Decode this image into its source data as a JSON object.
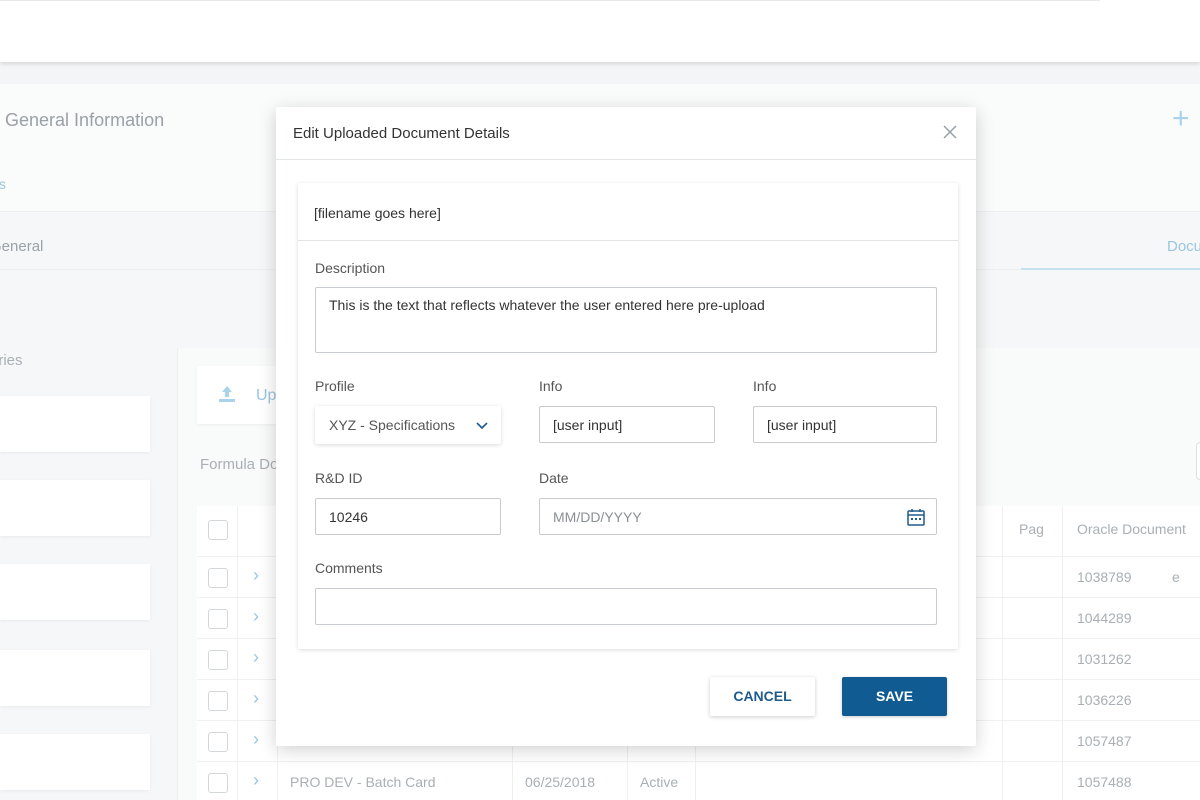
{
  "background": {
    "page_title": "on General Information",
    "subtitle": "als",
    "tab_general": "General",
    "tab_documents": "Docu",
    "categories_label": "ories",
    "upload_label": "Up",
    "formula_label": "Formula Do",
    "table": {
      "col_pag": "Pag",
      "col_oracle": "Oracle Document",
      "rows": [
        {
          "name": "",
          "date": "",
          "status": "",
          "partial": "e",
          "doc": "1038789"
        },
        {
          "name": "",
          "date": "",
          "status": "",
          "partial": "",
          "doc": "1044289"
        },
        {
          "name": "",
          "date": "",
          "status": "",
          "partial": "",
          "doc": "1031262"
        },
        {
          "name": "",
          "date": "",
          "status": "",
          "partial": "",
          "doc": "1036226"
        },
        {
          "name": "",
          "date": "",
          "status": "",
          "partial": "",
          "doc": "1057487"
        },
        {
          "name": "PRO DEV - Batch Card",
          "date": "06/25/2018",
          "status": "Active",
          "partial": "",
          "doc": "1057488"
        }
      ]
    }
  },
  "modal": {
    "title": "Edit Uploaded Document Details",
    "filename": "[filename goes here]",
    "description_label": "Description",
    "description_value": "This is the text that reflects whatever the user entered here pre-upload",
    "profile_label": "Profile",
    "profile_value": "XYZ - Specifications",
    "info1_label": "Info",
    "info1_value": "[user input]",
    "info2_label": "Info",
    "info2_value": "[user input]",
    "rd_id_label": "R&D ID",
    "rd_id_value": "10246",
    "date_label": "Date",
    "date_placeholder": "MM/DD/YYYY",
    "comments_label": "Comments",
    "comments_value": "",
    "cancel_label": "CANCEL",
    "save_label": "SAVE"
  },
  "icons": {
    "close": "close-icon",
    "chevron": "chevron-down-icon",
    "calendar": "calendar-icon",
    "upload": "upload-icon",
    "expand": "chevron-right-icon"
  },
  "colors": {
    "primary": "#105c92",
    "accent_light": "#9ac6de"
  }
}
